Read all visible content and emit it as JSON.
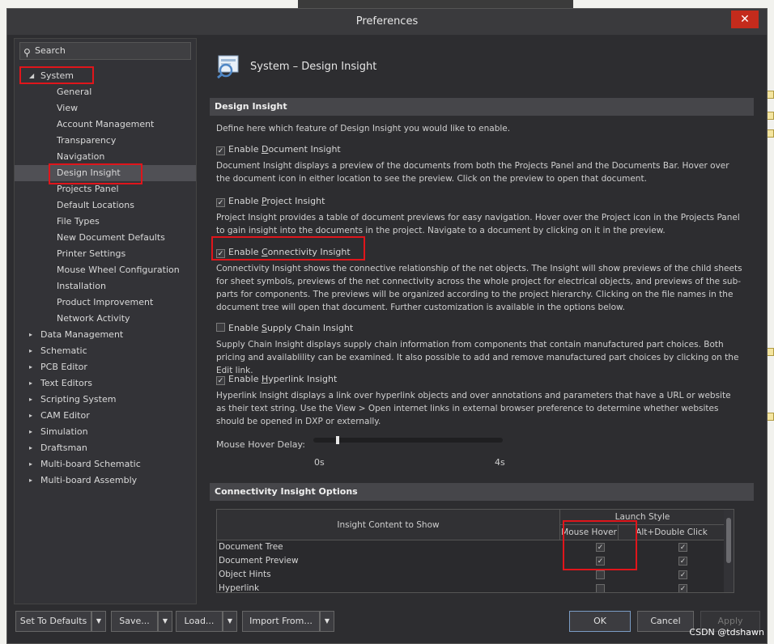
{
  "window": {
    "title": "Preferences",
    "close_label": "✕"
  },
  "search": {
    "placeholder": "Search",
    "icon": "search-icon"
  },
  "tree": {
    "root": "System",
    "children": [
      "General",
      "View",
      "Account Management",
      "Transparency",
      "Navigation",
      "Design Insight",
      "Projects Panel",
      "Default Locations",
      "File Types",
      "New Document Defaults",
      "Printer Settings",
      "Mouse Wheel Configuration",
      "Installation",
      "Product Improvement",
      "Network Activity"
    ],
    "selected": "Design Insight",
    "collapsed": [
      "Data Management",
      "Schematic",
      "PCB Editor",
      "Text Editors",
      "Scripting System",
      "CAM Editor",
      "Simulation",
      "Draftsman",
      "Multi-board Schematic",
      "Multi-board Assembly"
    ]
  },
  "page": {
    "title": "System – Design Insight",
    "icon": "design-insight-icon",
    "section_design_insight": "Design Insight",
    "intro": "Define here which feature of Design Insight you would like to enable.",
    "doc_insight": {
      "label_pre": "Enable ",
      "label_u": "D",
      "label_post": "ocument Insight",
      "checked": true,
      "desc": "Document Insight displays a preview of the documents from both the Projects Panel and the Documents Bar. Hover over the document icon in either location to see the preview. Click on the preview to open that document."
    },
    "proj_insight": {
      "label_pre": "Enable ",
      "label_u": "P",
      "label_post": "roject Insight",
      "checked": true,
      "desc": "Project Insight provides a table of document previews for easy navigation. Hover over the Project icon in the Projects Panel to gain insight into the documents in the project. Navigate to a document by clicking on it in the preview."
    },
    "conn_insight": {
      "label_pre": "Enable ",
      "label_u": "C",
      "label_post": "onnectivity Insight",
      "checked": true,
      "desc": "Connectivity Insight shows the connective relationship of the net objects. The Insight will show previews of the child sheets for sheet symbols, previews of the net connectivity across the whole project for electrical objects, and previews of the sub-parts for components. The previews will be organized according to the project hierarchy. Clicking on the file names in the document tree will open that document. Further customization is available in the options below."
    },
    "supply_insight": {
      "label_pre": "Enable ",
      "label_u": "S",
      "label_post": "upply Chain Insight",
      "checked": false,
      "desc": "Supply Chain Insight displays supply chain information from components that contain manufactured part choices. Both pricing and availablility can be examined. It also possible to add and remove manufactured part choices by clicking on the Edit link."
    },
    "hyper_insight": {
      "label_pre": "Enable ",
      "label_u": "H",
      "label_post": "yperlink Insight",
      "checked": true,
      "desc": "Hyperlink Insight displays a link over hyperlink objects and over annotations and parameters that have a URL or website as their text string. Use the View > Open internet links in external browser preference to determine whether websites should be opened in DXP or externally."
    },
    "hover_delay": {
      "label": "Mouse Hover Delay:",
      "min_label": "0s",
      "max_label": "4s",
      "value_fraction": 0.13
    },
    "section_options": "Connectivity Insight Options",
    "grid": {
      "col_content": "Insight Content to Show",
      "col_launch": "Launch Style",
      "col_hover": "Mouse Hover",
      "col_alt": "Alt+Double Click",
      "rows": [
        {
          "name": "Document Tree",
          "hover": true,
          "alt": true
        },
        {
          "name": "Document Preview",
          "hover": true,
          "alt": true
        },
        {
          "name": "Object Hints",
          "hover": false,
          "alt": true
        },
        {
          "name": "Hyperlink",
          "hover": false,
          "alt": true
        }
      ]
    }
  },
  "footer": {
    "set_defaults": "Set To Defaults",
    "save": "Save...",
    "load": "Load...",
    "import": "Import From...",
    "ok": "OK",
    "cancel": "Cancel",
    "apply": "Apply"
  },
  "watermark": "CSDN @tdshawn",
  "colors": {
    "highlight_box": "#e0151b",
    "accent": "#7a9cc4"
  }
}
